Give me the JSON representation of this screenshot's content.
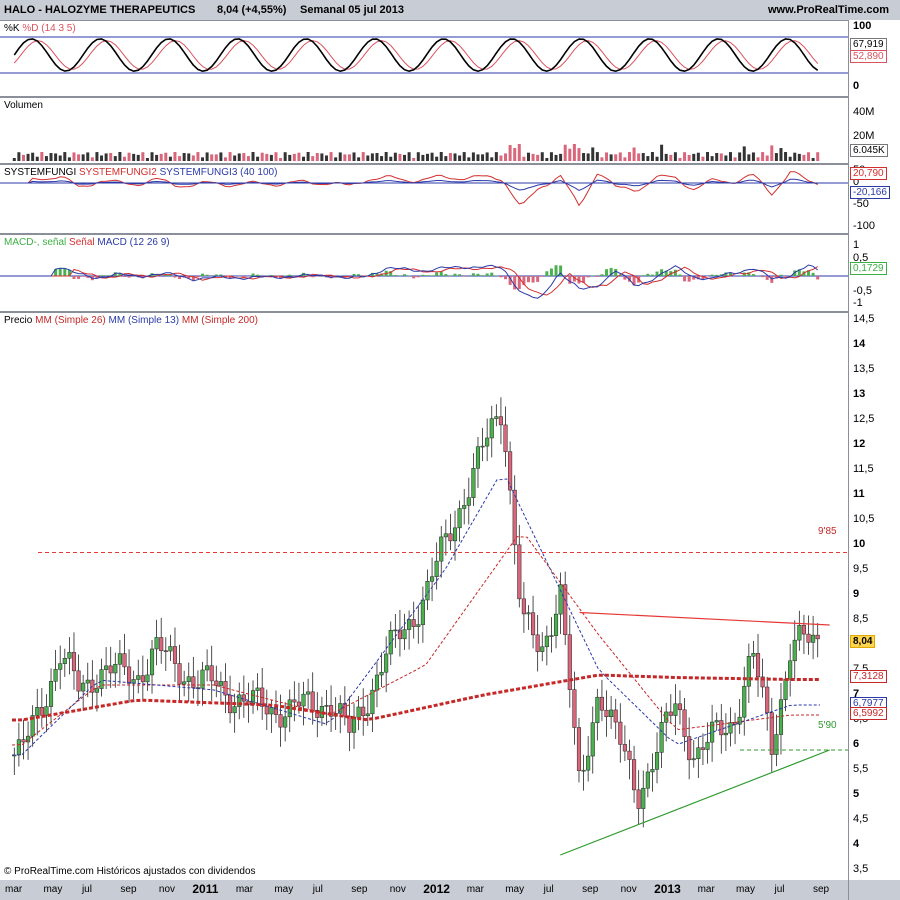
{
  "header": {
    "ticker": "HALO - HALOZYME THERAPEUTICS",
    "quote": "8,04 (+4,55%)",
    "period": "Semanal  05 jul 2013",
    "site": "www.ProRealTime.com"
  },
  "footer": {
    "copyright": "© ProRealTime.com Históricos ajustados con dividendos"
  },
  "colors": {
    "up": "#4caf50",
    "down": "#d9667a",
    "k": "#000000",
    "d": "#d9535f",
    "ma26": "#c62828",
    "ma13": "#2b3aa8",
    "ma200": "#c62828",
    "support": "#2e9a2e",
    "resist": "#e53935"
  },
  "panels": {
    "stoch": {
      "title_k": "%K",
      "title_d": "%D (14 3 5)",
      "ticks": [
        "100",
        "0"
      ],
      "value_k": "67,919",
      "value_d": "52,890"
    },
    "volume": {
      "title": "Volumen",
      "ticks": [
        "40M",
        "20M"
      ],
      "value": "6.045K"
    },
    "sysf": {
      "t1": "SYSTEMFUNGI",
      "t2": "SYSTEMFUNGI2",
      "t3": "SYSTEMFUNGI3 (40 100)",
      "ticks": [
        "50",
        "0",
        "-50",
        "-100"
      ],
      "value_red": "20,790",
      "value_blue": "-20,166"
    },
    "macd": {
      "t1": "MACD-, señal",
      "t2": "Señal",
      "t3": "MACD (12 26 9)",
      "ticks": [
        "1",
        "0,5",
        "-0,5",
        "-1"
      ],
      "value": "0,1729"
    },
    "price": {
      "t1": "Precio",
      "t2": "MM (Simple 26)",
      "t3": "MM (Simple 13)",
      "t4": "MM (Simple 200)",
      "ticks": [
        "14,5",
        "14",
        "13,5",
        "13",
        "12,5",
        "12",
        "11,5",
        "11",
        "10,5",
        "10",
        "9,5",
        "9",
        "8,5",
        "8",
        "7,5",
        "7",
        "6,5",
        "6",
        "5,5",
        "5",
        "4,5",
        "4",
        "3,5"
      ],
      "value_price": "8,04",
      "value_ma200": "7,3128",
      "value_ma13": "6,7977",
      "value_ma26": "6,5992",
      "ann_high": "9'85",
      "ann_low": "5'90"
    }
  },
  "xaxis": [
    {
      "label": "mar",
      "yr": false
    },
    {
      "label": "may",
      "yr": false
    },
    {
      "label": "jul",
      "yr": false
    },
    {
      "label": "sep",
      "yr": false
    },
    {
      "label": "nov",
      "yr": false
    },
    {
      "label": "2011",
      "yr": true
    },
    {
      "label": "mar",
      "yr": false
    },
    {
      "label": "may",
      "yr": false
    },
    {
      "label": "jul",
      "yr": false
    },
    {
      "label": "sep",
      "yr": false
    },
    {
      "label": "nov",
      "yr": false
    },
    {
      "label": "2012",
      "yr": true
    },
    {
      "label": "mar",
      "yr": false
    },
    {
      "label": "may",
      "yr": false
    },
    {
      "label": "jul",
      "yr": false
    },
    {
      "label": "sep",
      "yr": false
    },
    {
      "label": "nov",
      "yr": false
    },
    {
      "label": "2013",
      "yr": true
    },
    {
      "label": "mar",
      "yr": false
    },
    {
      "label": "may",
      "yr": false
    },
    {
      "label": "jul",
      "yr": false
    },
    {
      "label": "sep",
      "yr": false
    }
  ],
  "chart_data": {
    "type": "candlestick",
    "frequency": "weekly",
    "ylim": [
      3.5,
      14.5
    ],
    "levels": {
      "resistance": 9.85,
      "support": 5.9
    },
    "price_path": [
      [
        "2010-03",
        5.8
      ],
      [
        "2010-05",
        7.8
      ],
      [
        "2010-06",
        7.1
      ],
      [
        "2010-07",
        7.5
      ],
      [
        "2010-09",
        7.4
      ],
      [
        "2010-10",
        7.9
      ],
      [
        "2010-12",
        7.3
      ],
      [
        "2011-01",
        7.2
      ],
      [
        "2011-03",
        6.8
      ],
      [
        "2011-05",
        6.7
      ],
      [
        "2011-07",
        6.9
      ],
      [
        "2011-08",
        6.2
      ],
      [
        "2011-10",
        7.8
      ],
      [
        "2011-12",
        9.0
      ],
      [
        "2012-02",
        11.0
      ],
      [
        "2012-04",
        12.8
      ],
      [
        "2012-05",
        8.5
      ],
      [
        "2012-06",
        7.8
      ],
      [
        "2012-07",
        9.2
      ],
      [
        "2012-08",
        5.0
      ],
      [
        "2012-09",
        7.2
      ],
      [
        "2012-11",
        5.0
      ],
      [
        "2013-01",
        6.8
      ],
      [
        "2013-02",
        5.8
      ],
      [
        "2013-04",
        6.5
      ],
      [
        "2013-05",
        7.8
      ],
      [
        "2013-06",
        6.0
      ],
      [
        "2013-07",
        8.04
      ]
    ],
    "ma26_path": [
      [
        "2010-03",
        6.0
      ],
      [
        "2010-07",
        7.2
      ],
      [
        "2011-01",
        7.2
      ],
      [
        "2011-07",
        6.6
      ],
      [
        "2011-12",
        7.6
      ],
      [
        "2012-05",
        10.3
      ],
      [
        "2012-09",
        8.2
      ],
      [
        "2013-01",
        6.3
      ],
      [
        "2013-07",
        6.6
      ]
    ],
    "ma13_path": [
      [
        "2010-03",
        5.8
      ],
      [
        "2010-07",
        7.3
      ],
      [
        "2011-01",
        7.1
      ],
      [
        "2011-07",
        6.4
      ],
      [
        "2012-01",
        9.5
      ],
      [
        "2012-04",
        11.5
      ],
      [
        "2012-09",
        7.5
      ],
      [
        "2013-01",
        6.0
      ],
      [
        "2013-07",
        6.8
      ]
    ],
    "ma200_path": [
      [
        "2010-03",
        6.5
      ],
      [
        "2010-09",
        6.9
      ],
      [
        "2011-04",
        6.8
      ],
      [
        "2011-09",
        6.5
      ],
      [
        "2012-03",
        7.0
      ],
      [
        "2012-09",
        7.4
      ],
      [
        "2013-01",
        7.35
      ],
      [
        "2013-07",
        7.31
      ]
    ],
    "trendlines": [
      {
        "name": "resistance",
        "from": [
          "2012-08",
          8.65
        ],
        "to": [
          "2013-09",
          8.4
        ]
      },
      {
        "name": "rising-support",
        "from": [
          "2012-07",
          3.8
        ],
        "to": [
          "2013-09",
          5.9
        ]
      }
    ]
  }
}
